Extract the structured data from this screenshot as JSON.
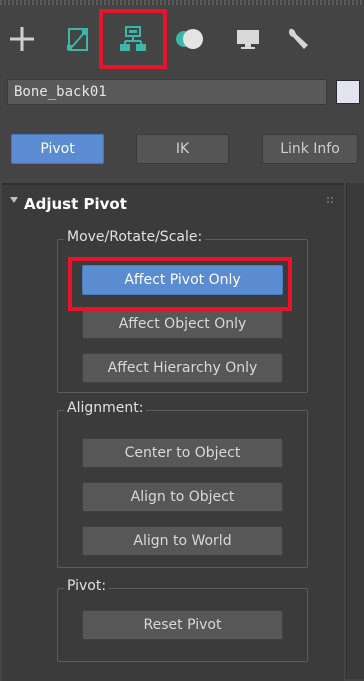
{
  "colors": {
    "accent": "#5b8bd0",
    "highlight": "#e8132a",
    "panel": "#3b3b3b"
  },
  "tabs": [
    {
      "icon": "plus-icon",
      "selected": false
    },
    {
      "icon": "shape-create-icon",
      "selected": false
    },
    {
      "icon": "hierarchy-icon",
      "selected": true
    },
    {
      "icon": "motion-sphere-icon",
      "selected": false
    },
    {
      "icon": "display-monitor-icon",
      "selected": false
    },
    {
      "icon": "wrench-icon",
      "selected": false
    }
  ],
  "object": {
    "name": "Bone_back01"
  },
  "modes": {
    "pivot": "Pivot",
    "ik": "IK",
    "link_info": "Link Info"
  },
  "rollout": {
    "title": "Adjust Pivot"
  },
  "groups": {
    "move": {
      "label": "Move/Rotate/Scale:",
      "buttons": [
        "Affect Pivot Only",
        "Affect Object Only",
        "Affect Hierarchy Only"
      ]
    },
    "alignment": {
      "label": "Alignment:",
      "buttons": [
        "Center to Object",
        "Align to Object",
        "Align to World"
      ]
    },
    "pivot": {
      "label": "Pivot:",
      "buttons": [
        "Reset Pivot"
      ]
    }
  }
}
